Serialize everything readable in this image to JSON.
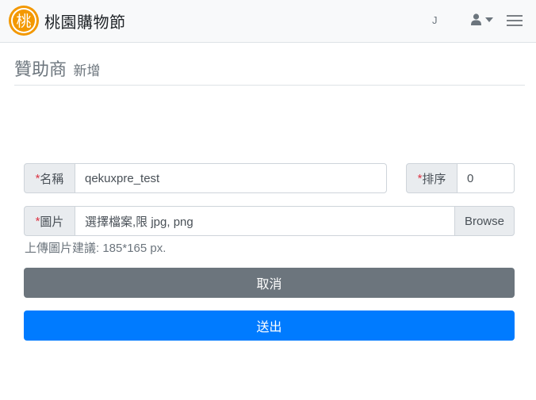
{
  "navbar": {
    "brand_name": "桃園購物節",
    "logo_glyph": "桃",
    "user_initial": "J",
    "icons": [
      "user-icon",
      "caret-down-icon",
      "menu-icon"
    ]
  },
  "page": {
    "title": "贊助商",
    "subtitle": "新增"
  },
  "form": {
    "name_label": "名稱",
    "name_value": "qekuxpre_test",
    "order_label": "排序",
    "order_value": "0",
    "image_label": "圖片",
    "image_placeholder": "選擇檔案,限 jpg, png",
    "browse_label": "Browse",
    "required_mark": "*",
    "hint": "上傳圖片建議: 185*165 px.",
    "cancel_label": "取消",
    "submit_label": "送出"
  },
  "colors": {
    "primary": "#007bff",
    "secondary": "#6c757d",
    "required": "#dc3545",
    "logo_orange": "#f39800"
  }
}
